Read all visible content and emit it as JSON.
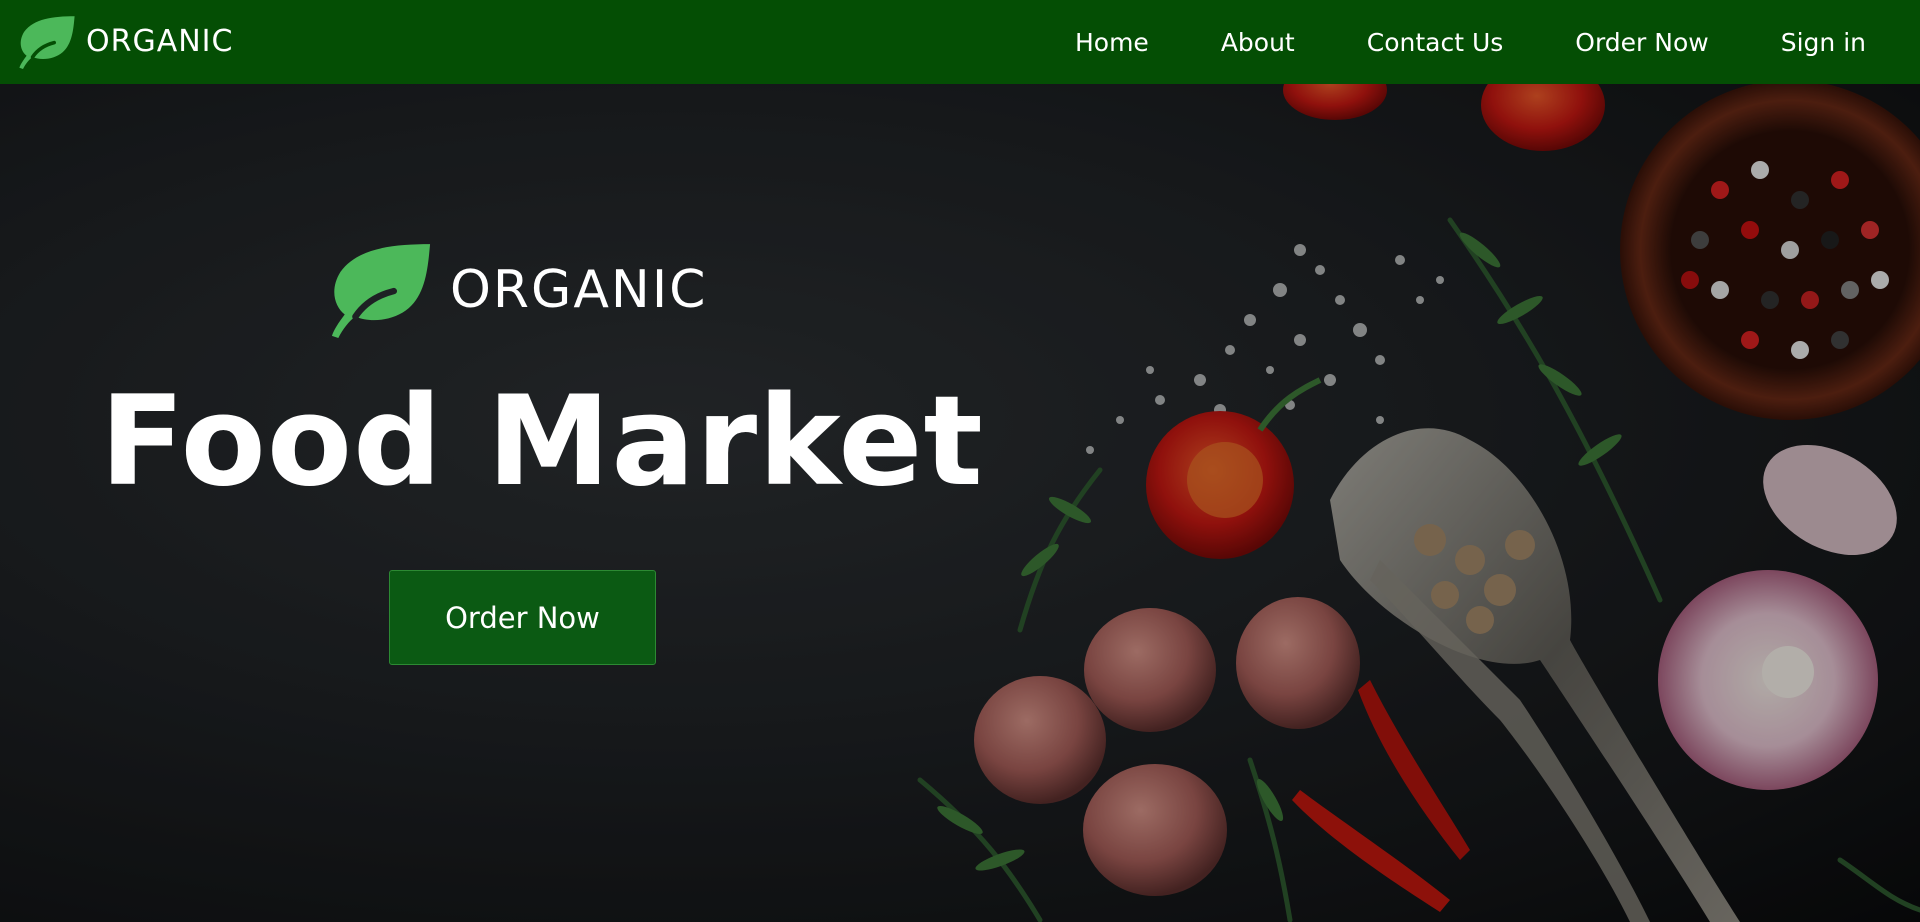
{
  "navbar": {
    "brand": "ORGANIC",
    "links": [
      "Home",
      "About",
      "Contact Us",
      "Order Now",
      "Sign in"
    ]
  },
  "hero": {
    "brand": "ORGANIC",
    "title": "Food Market",
    "cta_label": "Order Now"
  },
  "colors": {
    "nav_background": "#044e04",
    "leaf_green": "#4cb85a",
    "cta_background": "#0b5a13"
  },
  "icons": {
    "brand_logo": "leaf-icon"
  }
}
